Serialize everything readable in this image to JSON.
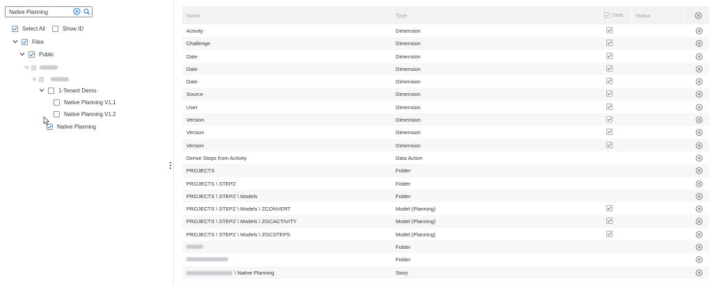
{
  "left_panel": {
    "search": {
      "value": "Native Planning"
    },
    "select_all_label": "Select All",
    "show_id_label": "Show ID",
    "tree": {
      "files_label": "Files",
      "public_label": "Public",
      "tenant_demo_label": "1-Tenant Demo",
      "item_v11_label": "Native Planning V1.1",
      "item_v12_label": "Native Planning V1.2",
      "native_planning_label": "Native Planning"
    }
  },
  "table": {
    "headers": {
      "name": "Name",
      "type": "Type",
      "data": "Data",
      "status": "Status"
    },
    "rows": [
      {
        "name": "Activity",
        "type": "Dimension",
        "data": true
      },
      {
        "name": "Challenge",
        "type": "Dimension",
        "data": true
      },
      {
        "name": "Date",
        "type": "Dimension",
        "data": true
      },
      {
        "name": "Date",
        "type": "Dimension",
        "data": true
      },
      {
        "name": "Date",
        "type": "Dimension",
        "data": true
      },
      {
        "name": "Source",
        "type": "Dimension",
        "data": true
      },
      {
        "name": "User",
        "type": "Dimension",
        "data": true
      },
      {
        "name": "Version",
        "type": "Dimension",
        "data": true
      },
      {
        "name": "Version",
        "type": "Dimension",
        "data": true
      },
      {
        "name": "Version",
        "type": "Dimension",
        "data": true
      },
      {
        "name": "Derive Steps from Activity",
        "type": "Data Action",
        "data": false
      },
      {
        "name": "PROJECTS",
        "type": "Folder",
        "data": false
      },
      {
        "name": "PROJECTS \\ STEPZ",
        "type": "Folder",
        "data": false
      },
      {
        "name": "PROJECTS \\ STEPZ \\ Models",
        "type": "Folder",
        "data": false
      },
      {
        "name": "PROJECTS \\ STEPZ \\ Models \\ ZCONVERT",
        "type": "Model (Planning)",
        "data": true
      },
      {
        "name": "PROJECTS \\ STEPZ \\ Models \\ ZGCACTIVITY",
        "type": "Model (Planning)",
        "data": true
      },
      {
        "name": "PROJECTS \\ STEPZ \\ Models \\ ZGCSTEPS",
        "type": "Model (Planning)",
        "data": true
      },
      {
        "name": "",
        "type": "Folder",
        "data": false,
        "blurred": "short"
      },
      {
        "name": "",
        "type": "Folder",
        "data": false,
        "blurred": "long"
      },
      {
        "name": "\\ Native Planning",
        "type": "Story",
        "data": false,
        "blurred": "prefix"
      }
    ]
  }
}
